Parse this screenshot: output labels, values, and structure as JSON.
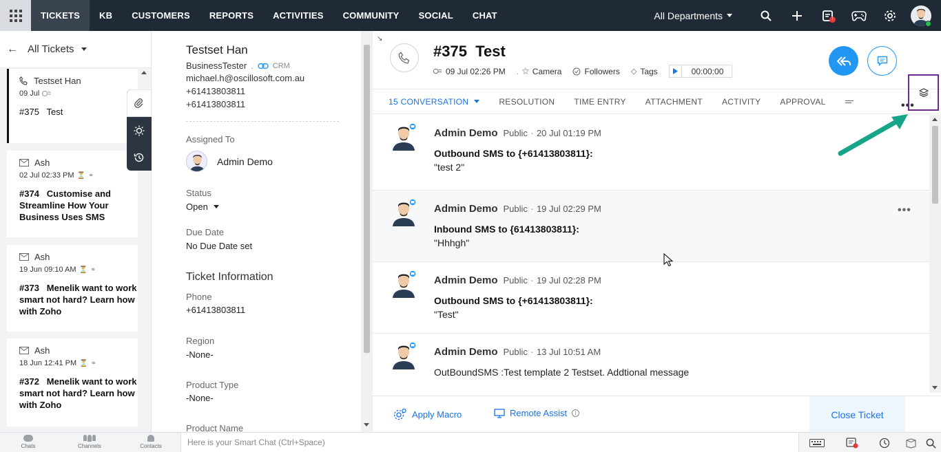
{
  "nav": {
    "items": [
      "TICKETS",
      "KB",
      "CUSTOMERS",
      "REPORTS",
      "ACTIVITIES",
      "COMMUNITY",
      "SOCIAL",
      "CHAT"
    ],
    "department": "All Departments",
    "notification_badge": "!"
  },
  "list": {
    "title": "All Tickets",
    "tickets": [
      {
        "contact": "Testset Han",
        "date": "09 Jul",
        "number": "#375",
        "subject": "Test"
      },
      {
        "contact": "Ash",
        "date": "02 Jul 02:33 PM",
        "number": "#374",
        "subject": "Customise and Streamline How Your Business Uses SMS"
      },
      {
        "contact": "Ash",
        "date": "19 Jun 09:10 AM",
        "number": "#373",
        "subject": "Menelik want to work smart not hard? Learn how with Zoho"
      },
      {
        "contact": "Ash",
        "date": "18 Jun 12:41 PM",
        "number": "#372",
        "subject": "Menelik want to work smart not hard? Learn how with Zoho"
      }
    ]
  },
  "contact": {
    "name": "Testset Han",
    "account": "BusinessTester",
    "crm": "CRM",
    "email": "michael.h@oscillosoft.com.au",
    "phone1": "+61413803811",
    "phone2": "+61413803811",
    "assigned_label": "Assigned To",
    "assigned_to": "Admin Demo",
    "status_label": "Status",
    "status": "Open",
    "due_label": "Due Date",
    "due": "No Due Date set",
    "info_title": "Ticket Information",
    "phone_label": "Phone",
    "phone": "+61413803811",
    "region_label": "Region",
    "region": "-None-",
    "product_type_label": "Product Type",
    "product_type": "-None-",
    "product_name_label": "Product Name"
  },
  "ticket": {
    "number": "#375",
    "title": "Test",
    "date": "09 Jul 02:26 PM",
    "channel": "Camera",
    "followers": "Followers",
    "tags": "Tags",
    "timer": "00:00:00"
  },
  "tabs": [
    "15 CONVERSATION",
    "RESOLUTION",
    "TIME ENTRY",
    "ATTACHMENT",
    "ACTIVITY",
    "APPROVAL"
  ],
  "messages": [
    {
      "author": "Admin Demo",
      "visibility": "Public",
      "when": "20 Jul 01:19 PM",
      "head": "Outbound SMS to {+61413803811}:",
      "body": "\"test 2\""
    },
    {
      "author": "Admin Demo",
      "visibility": "Public",
      "when": "19 Jul 02:29 PM",
      "head": "Inbound SMS to {61413803811}:",
      "body": "\"Hhhgh\""
    },
    {
      "author": "Admin Demo",
      "visibility": "Public",
      "when": "19 Jul 02:28 PM",
      "head": "Outbound SMS to {+61413803811}:",
      "body": "\"Test\""
    },
    {
      "author": "Admin Demo",
      "visibility": "Public",
      "when": "13 Jul 10:51 AM",
      "body": "OutBoundSMS :Test template 2 Testset. Addtional message"
    }
  ],
  "footer": {
    "apply_macro": "Apply Macro",
    "remote_assist": "Remote Assist",
    "close_ticket": "Close Ticket"
  },
  "bottom": {
    "chats": "Chats",
    "channels": "Channels",
    "contacts": "Contacts",
    "smart_chat_placeholder": "Here is your Smart Chat (Ctrl+Space)"
  },
  "colors": {
    "nav_bg": "#202a37",
    "accent": "#2196f3",
    "highlight_box": "#6a2c91",
    "arrow": "#17a589"
  }
}
